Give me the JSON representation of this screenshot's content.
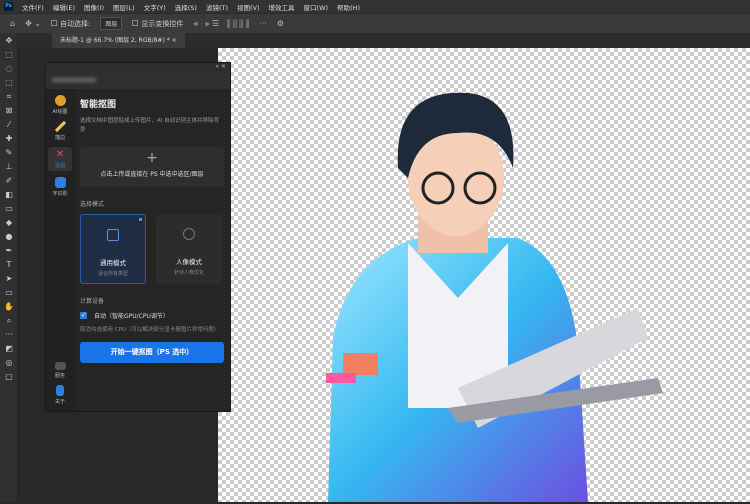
{
  "menubar": {
    "logo": "Ps",
    "items": [
      "文件(F)",
      "编辑(E)",
      "图像(I)",
      "图层(L)",
      "文字(Y)",
      "选择(S)",
      "滤镜(T)",
      "视图(V)",
      "增效工具",
      "窗口(W)",
      "帮助(H)"
    ]
  },
  "options": {
    "auto_select_label": "自动选择:",
    "auto_select_value": "图层",
    "show_transform_label": "显示变换控件",
    "more": "···"
  },
  "document_tab": {
    "title": "未标题-1 @ 66.7% (图层 2, RGB/8#) *",
    "close": "×"
  },
  "panel": {
    "header_controls": "» ✕",
    "sidebar": [
      {
        "label": "AI绘图",
        "color": "#e0a030"
      },
      {
        "label": "描边",
        "color": "#e8c060"
      },
      {
        "label": "抠图",
        "color": "#c04040"
      },
      {
        "label": "字识别",
        "color": "#2f7fe0"
      }
    ],
    "sidebar_bottom": [
      {
        "label": "服务"
      },
      {
        "label": "关于"
      }
    ],
    "title": "智能抠图",
    "description": "选择文档中图层贴或上传图片，AI 自动识别主体并移除背景",
    "upload_plus": "+",
    "upload_text": "点击上传或直接在 PS 中选中选区/图层",
    "mode_label": "选择模式",
    "modes": [
      {
        "title": "通用模式",
        "subtitle": "适合所有类型",
        "active": true
      },
      {
        "title": "人像模式",
        "subtitle": "针对人像优化",
        "active": false
      }
    ],
    "device_label": "计算设备",
    "auto_checkbox": {
      "label": "自动（智能GPU/CPU调节）",
      "checked": true
    },
    "note": "取消勾选使用 CPU（可以解决部分显卡报图片异常问题）",
    "start_button": "开始一键抠图（PS 选中）"
  },
  "colors": {
    "accent": "#1a73e8"
  }
}
